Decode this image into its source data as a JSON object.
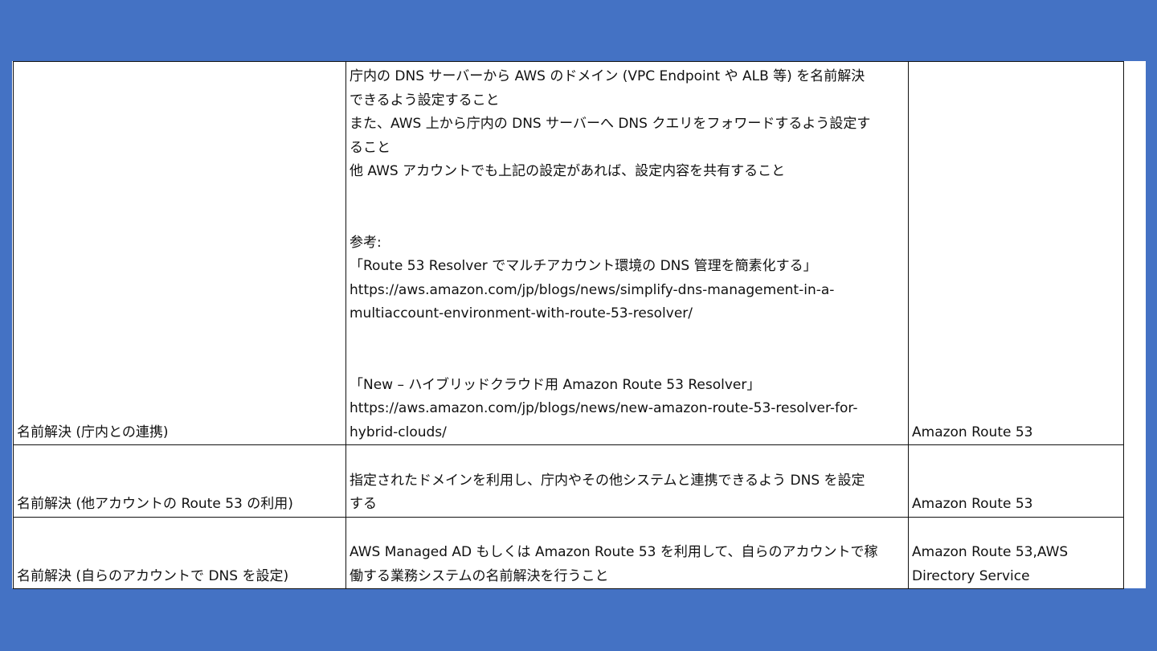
{
  "rows": [
    {
      "category": "名前解決 (庁内との連携)",
      "requirement_lines": [
        "庁内の DNS サーバーから AWS のドメイン (VPC Endpoint や ALB 等) を名前解決",
        "できるよう設定すること",
        "また、AWS 上から庁内の DNS サーバーへ DNS クエリをフォワードするよう設定す",
        "ること",
        "他 AWS アカウントでも上記の設定があれば、設定内容を共有すること",
        "",
        "",
        "参考:",
        "「Route 53 Resolver でマルチアカウント環境の DNS 管理を簡素化する」",
        "https://aws.amazon.com/jp/blogs/news/simplify-dns-management-in-a-",
        "multiaccount-environment-with-route-53-resolver/",
        "",
        "",
        "「New – ハイブリッドクラウド用 Amazon Route 53 Resolver」",
        "https://aws.amazon.com/jp/blogs/news/new-amazon-route-53-resolver-for-",
        "hybrid-clouds/"
      ],
      "service_lines": [
        "Amazon Route 53"
      ]
    },
    {
      "category": "名前解決 (他アカウントの Route 53 の利用)",
      "requirement_lines": [
        "",
        "指定されたドメインを利用し、庁内やその他システムと連携できるよう DNS を設定",
        "する"
      ],
      "service_lines": [
        "Amazon Route 53"
      ]
    },
    {
      "category": "名前解決 (自らのアカウントで DNS を設定)",
      "requirement_lines": [
        "",
        "AWS Managed AD もしくは Amazon Route 53 を利用して、自らのアカウントで稼",
        "働する業務システムの名前解決を行うこと"
      ],
      "service_lines": [
        "Amazon Route 53,AWS",
        "Directory Service"
      ]
    }
  ]
}
